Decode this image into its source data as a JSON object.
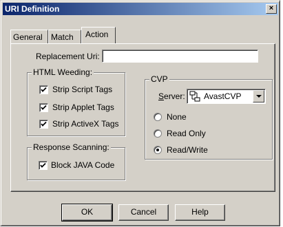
{
  "window": {
    "title": "URI Definition"
  },
  "tabs": [
    {
      "label": "General",
      "active": false
    },
    {
      "label": "Match",
      "active": false
    },
    {
      "label": "Action",
      "active": true
    }
  ],
  "replacement_uri": {
    "label": "Replacement Uri:",
    "value": ""
  },
  "html_weeding": {
    "title": "HTML Weeding:",
    "items": [
      {
        "label": "Strip Script Tags",
        "checked": true
      },
      {
        "label": "Strip Applet Tags",
        "checked": true
      },
      {
        "label": "Strip ActiveX Tags",
        "checked": true
      }
    ]
  },
  "response_scanning": {
    "title": "Response Scanning:",
    "items": [
      {
        "label": "Block JAVA Code",
        "checked": true
      }
    ]
  },
  "cvp": {
    "title": "CVP",
    "server_label": "Server:",
    "server_value": "AvastCVP",
    "options": [
      {
        "label": "None",
        "selected": false
      },
      {
        "label": "Read Only",
        "selected": false
      },
      {
        "label": "Read/Write",
        "selected": true
      }
    ]
  },
  "buttons": {
    "ok": "OK",
    "cancel": "Cancel",
    "help": "Help"
  },
  "icons": {
    "close": "close-icon",
    "server": "server-icon",
    "dropdown": "chevron-down-icon",
    "check": "checkmark-icon"
  }
}
